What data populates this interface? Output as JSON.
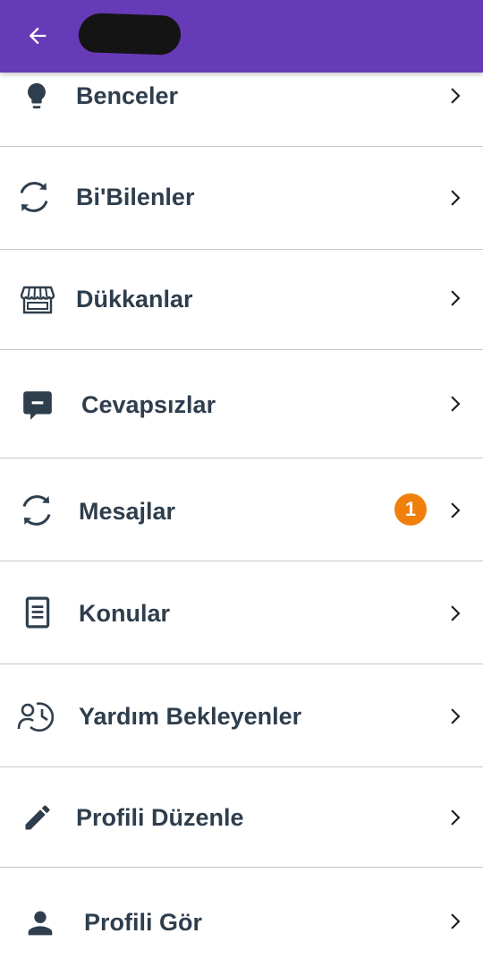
{
  "header": {
    "back_icon": "arrow-left-icon",
    "background_color": "#673ab7",
    "title_redacted": true
  },
  "menu": {
    "items": [
      {
        "label": "Benceler",
        "icon": "lightbulb-icon"
      },
      {
        "label": "Bi'Bilenler",
        "icon": "refresh-icon"
      },
      {
        "label": "Dükkanlar",
        "icon": "store-icon"
      },
      {
        "label": "Cevapsızlar",
        "icon": "comment-icon"
      },
      {
        "label": "Mesajlar",
        "icon": "refresh-icon",
        "badge": "1"
      },
      {
        "label": "Konular",
        "icon": "document-icon"
      },
      {
        "label": "Yardım Bekleyenler",
        "icon": "people-clock-icon"
      },
      {
        "label": "Profili Düzenle",
        "icon": "pencil-icon"
      },
      {
        "label": "Profili Gör",
        "icon": "person-icon"
      }
    ],
    "chevron_icon": "chevron-right-icon",
    "badge_color": "#f0800c",
    "text_color": "#2f3e4d"
  }
}
